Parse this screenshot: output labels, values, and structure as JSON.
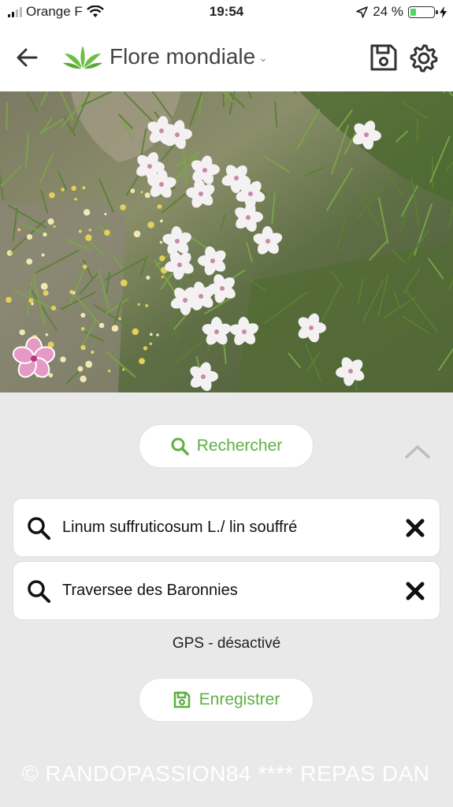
{
  "status_bar": {
    "carrier": "Orange F",
    "time": "19:54",
    "battery_percent": "24 %",
    "battery_level": 0.24
  },
  "header": {
    "title": "Flore mondiale",
    "icons": [
      "back-arrow-icon",
      "plant-logo-icon",
      "chevron-down-icon",
      "floppy-disk-icon",
      "gear-icon"
    ]
  },
  "panel": {
    "search_button_label": "Rechercher",
    "species_field_value": "Linum suffruticosum L./ lin souffré",
    "location_field_value": "Traversee des Baronnies",
    "gps_status": "GPS - désactivé",
    "save_button_label": "Enregistrer",
    "watermark": "© RANDOPASSION84 ****   REPAS DAN"
  },
  "colors": {
    "accent_green": "#5fb043",
    "panel_bg": "#e9e9e9",
    "battery_fill": "#4cd964"
  }
}
